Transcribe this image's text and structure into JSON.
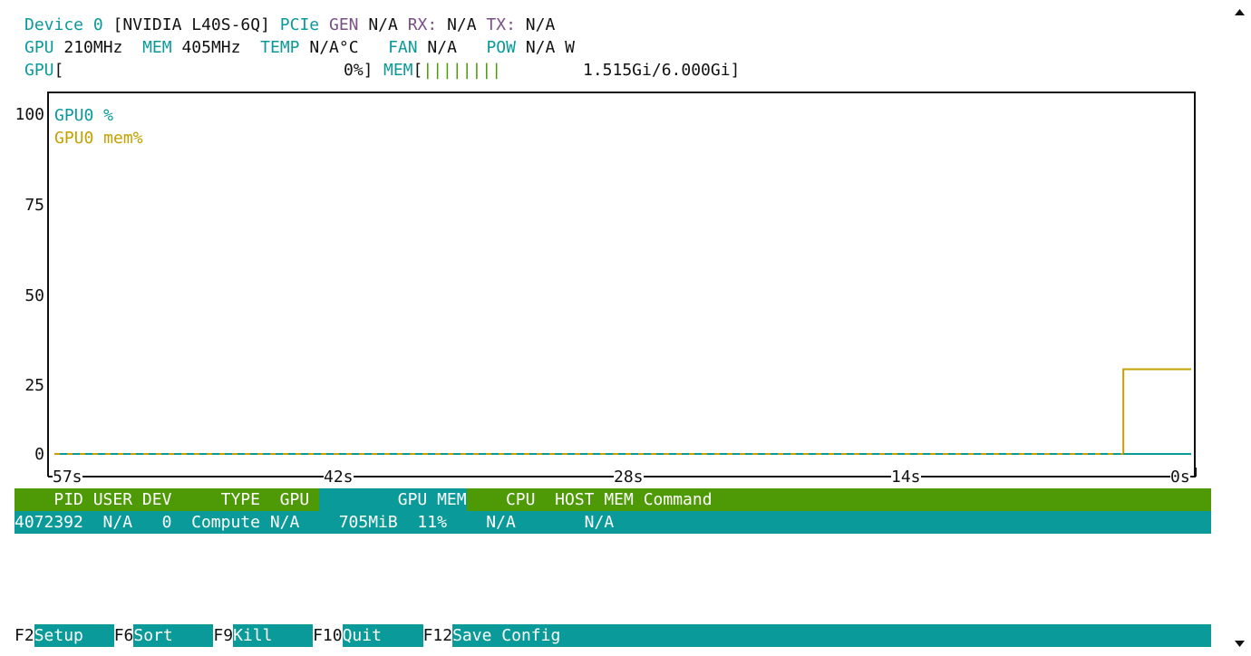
{
  "device": {
    "label": "Device 0",
    "name": "[NVIDIA L40S-6Q]",
    "pcie_label": "PCIe",
    "gen_label": "GEN",
    "gen_value": "N/A",
    "rx_label": "RX:",
    "rx_value": "N/A",
    "tx_label": "TX:",
    "tx_value": "N/A"
  },
  "stats": {
    "gpu_label": "GPU",
    "gpu_clock": "210MHz",
    "mem_label": "MEM",
    "mem_clock": "405MHz",
    "temp_label": "TEMP",
    "temp_value": "N/A°C",
    "fan_label": "FAN",
    "fan_value": "N/A",
    "pow_label": "POW",
    "pow_value": "N/A W"
  },
  "meters": {
    "gpu_label": "GPU",
    "gpu_open": "[",
    "gpu_text": "0%]",
    "gpu_util_percent": 0,
    "mem_label": "MEM",
    "mem_open": "[",
    "mem_bars": "||||||||",
    "mem_text": "1.515Gi/6.000Gi]",
    "mem_used_gib": 1.515,
    "mem_total_gib": 6.0
  },
  "chart_data": {
    "type": "line",
    "y_ticks": [
      "100",
      "75",
      "50",
      "25",
      "0"
    ],
    "x_ticks": [
      "57s",
      "42s",
      "28s",
      "14s",
      "0s"
    ],
    "ylim": [
      0,
      100
    ],
    "xlim_seconds_ago": [
      57,
      0
    ],
    "legend_placement": "top-left",
    "grid": false,
    "series": [
      {
        "name": "GPU0 %",
        "color": "#0b9a9a",
        "points": [
          [
            57,
            0
          ],
          [
            0,
            0
          ]
        ]
      },
      {
        "name": "GPU0 mem%",
        "color": "#c4a000",
        "points": [
          [
            57,
            0
          ],
          [
            3.4,
            0
          ],
          [
            3.4,
            25
          ],
          [
            0,
            25
          ]
        ]
      }
    ]
  },
  "process_table": {
    "headers": {
      "pid": "PID",
      "user": "USER",
      "dev": "DEV",
      "type": "TYPE",
      "gpu": "GPU",
      "gpu_mem": "GPU MEM",
      "cpu": "CPU",
      "host_mem": "HOST MEM",
      "command": "Command"
    },
    "rows": [
      {
        "pid": "4072392",
        "user": "N/A",
        "dev": "0",
        "type": "Compute",
        "gpu": "N/A",
        "gpu_mem": "705MiB",
        "gpu_mem_pct": "11%",
        "cpu": "N/A",
        "host_mem": "N/A",
        "command": ""
      }
    ]
  },
  "footer": [
    {
      "key": "F2",
      "label": "Setup"
    },
    {
      "key": "F6",
      "label": "Sort"
    },
    {
      "key": "F9",
      "label": "Kill"
    },
    {
      "key": "F10",
      "label": "Quit"
    },
    {
      "key": "F12",
      "label": "Save Config"
    }
  ],
  "colors": {
    "teal": "#0b9a9a",
    "green": "#4e9a06",
    "yellow": "#c4a000",
    "purple": "#7a4f86"
  }
}
